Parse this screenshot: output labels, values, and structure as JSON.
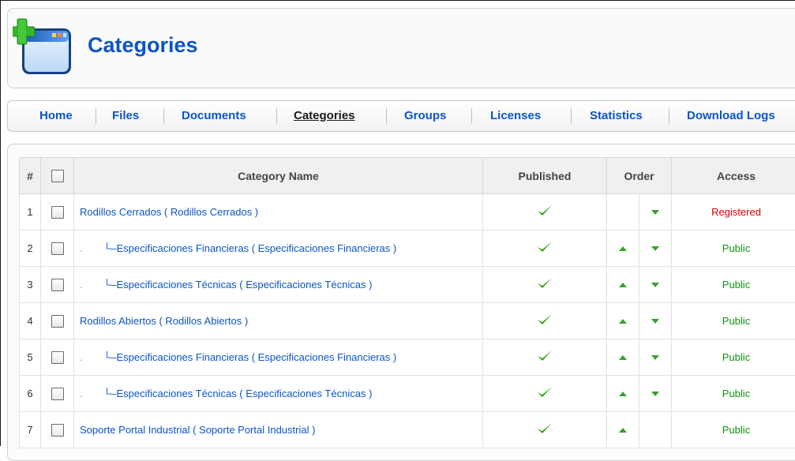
{
  "header": {
    "title": "Categories"
  },
  "nav": {
    "items": [
      {
        "label": "Home",
        "active": false
      },
      {
        "label": "Files",
        "active": false
      },
      {
        "label": "Documents",
        "active": false
      },
      {
        "label": "Categories",
        "active": true
      },
      {
        "label": "Groups",
        "active": false
      },
      {
        "label": "Licenses",
        "active": false
      },
      {
        "label": "Statistics",
        "active": false
      },
      {
        "label": "Download Logs",
        "active": false
      }
    ]
  },
  "table": {
    "columns": {
      "num": "#",
      "name": "Category Name",
      "published": "Published",
      "order": "Order",
      "access": "Access"
    },
    "rows": [
      {
        "num": "1",
        "level": 0,
        "prefix": "",
        "name": "Rodillos Cerrados ( Rodillos Cerrados )",
        "published": true,
        "up": false,
        "down": true,
        "access": "Registered"
      },
      {
        "num": "2",
        "level": 1,
        "prefix": ".",
        "name": "Especificaciones Financieras ( Especificaciones Financieras )",
        "published": true,
        "up": true,
        "down": true,
        "access": "Public"
      },
      {
        "num": "3",
        "level": 1,
        "prefix": ".",
        "name": "Especificaciones Técnicas ( Especificaciones Técnicas )",
        "published": true,
        "up": true,
        "down": true,
        "access": "Public"
      },
      {
        "num": "4",
        "level": 0,
        "prefix": "",
        "name": "Rodillos Abiertos ( Rodillos Abiertos )",
        "published": true,
        "up": true,
        "down": true,
        "access": "Public"
      },
      {
        "num": "5",
        "level": 1,
        "prefix": ".",
        "name": "Especificaciones Financieras ( Especificaciones Financieras )",
        "published": true,
        "up": true,
        "down": true,
        "access": "Public"
      },
      {
        "num": "6",
        "level": 1,
        "prefix": ".",
        "name": "Especificaciones Técnicas ( Especificaciones Técnicas )",
        "published": true,
        "up": true,
        "down": true,
        "access": "Public"
      },
      {
        "num": "7",
        "level": 0,
        "prefix": "",
        "name": "Soporte Portal Industrial ( Soporte Portal Industrial )",
        "published": true,
        "up": true,
        "down": false,
        "access": "Public"
      }
    ],
    "tree_branch": "└–"
  },
  "icons": {
    "header": "categories-window-icon",
    "published": "checkmark-icon",
    "up": "arrow-up-icon",
    "down": "arrow-down-icon"
  },
  "colors": {
    "link": "#0b55c4",
    "registered": "#dd0000",
    "public": "#138f13",
    "check": "#2e9e11",
    "arrow": "#38a02c"
  }
}
